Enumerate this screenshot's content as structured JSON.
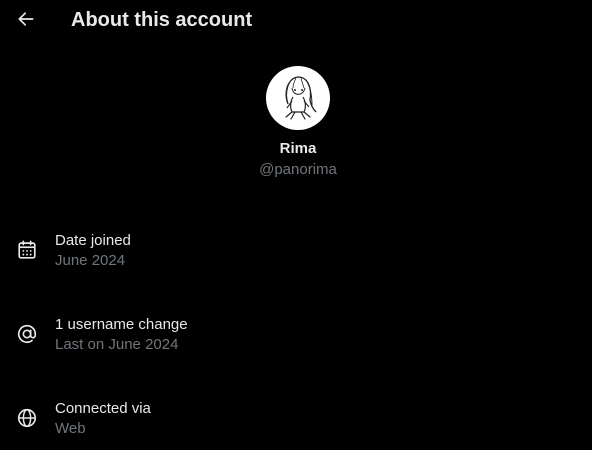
{
  "header": {
    "title": "About this account"
  },
  "profile": {
    "display_name": "Rima",
    "handle": "@panorima"
  },
  "info": [
    {
      "icon": "calendar-icon",
      "label": "Date joined",
      "value": "June 2024"
    },
    {
      "icon": "at-sign-icon",
      "label": "1 username change",
      "value": "Last on June 2024"
    },
    {
      "icon": "globe-icon",
      "label": "Connected via",
      "value": "Web"
    }
  ],
  "colors": {
    "background": "#000000",
    "primary_text": "#e7e9ea",
    "secondary_text": "#71767b"
  }
}
